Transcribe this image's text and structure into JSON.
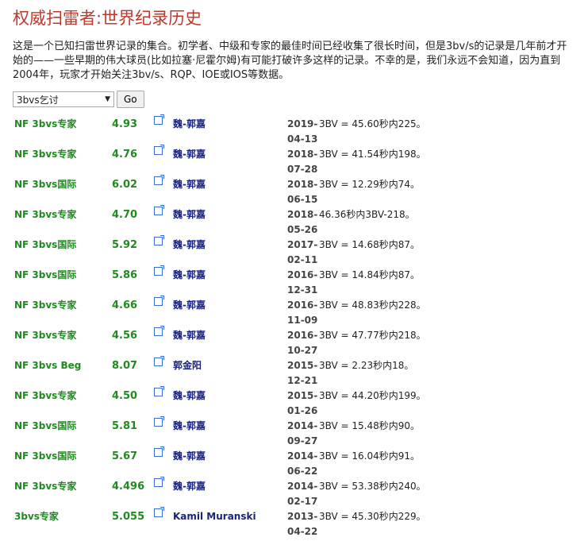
{
  "page": {
    "title": "权威扫雷者:世界纪录历史",
    "intro": "这是一个已知扫雷世界记录的集合。初学者、中级和专家的最佳时间已经收集了很长时间，但是3bv/s的记录是几年前才开始的——一些早期的伟大球员(比如拉塞·尼霍尔姆)有可能打破许多这样的记录。不幸的是，我们永远不会知道，因为直到2004年，玩家才开始关注3bv/s、RQP、IOE或IOS等数据。"
  },
  "controls": {
    "select_value": "3bvs乞讨",
    "go_label": "Go"
  },
  "records": [
    {
      "type": "NF 3bvs专家",
      "value": "4.93",
      "name": "魏-郭嘉",
      "date_line1": "2019-",
      "date_line2": "04-13",
      "desc": "3BV = 45.60秒内225。"
    },
    {
      "type": "NF 3bvs专家",
      "value": "4.76",
      "name": "魏-郭嘉",
      "date_line1": "2018-",
      "date_line2": "07-28",
      "desc": "3BV = 41.54秒内198。"
    },
    {
      "type": "NF 3bvs国际",
      "value": "6.02",
      "name": "魏-郭嘉",
      "date_line1": "2018-",
      "date_line2": "06-15",
      "desc": "3BV = 12.29秒内74。"
    },
    {
      "type": "NF 3bvs专家",
      "value": "4.70",
      "name": "魏-郭嘉",
      "date_line1": "2018-",
      "date_line2": "05-26",
      "desc": "46.36秒内3BV-218。"
    },
    {
      "type": "NF 3bvs国际",
      "value": "5.92",
      "name": "魏-郭嘉",
      "date_line1": "2017-",
      "date_line2": "02-11",
      "desc": "3BV = 14.68秒内87。"
    },
    {
      "type": "NF 3bvs国际",
      "value": "5.86",
      "name": "魏-郭嘉",
      "date_line1": "2016-",
      "date_line2": "12-31",
      "desc": "3BV = 14.84秒内87。"
    },
    {
      "type": "NF 3bvs专家",
      "value": "4.66",
      "name": "魏-郭嘉",
      "date_line1": "2016-",
      "date_line2": "11-09",
      "desc": "3BV = 48.83秒内228。"
    },
    {
      "type": "NF 3bvs专家",
      "value": "4.56",
      "name": "魏-郭嘉",
      "date_line1": "2016-",
      "date_line2": "10-27",
      "desc": "3BV = 47.77秒内218。"
    },
    {
      "type": "NF 3bvs Beg",
      "value": "8.07",
      "name": "郭金阳",
      "date_line1": "2015-",
      "date_line2": "12-21",
      "desc": "3BV = 2.23秒内18。"
    },
    {
      "type": "NF 3bvs专家",
      "value": "4.50",
      "name": "魏-郭嘉",
      "date_line1": "2015-",
      "date_line2": "01-26",
      "desc": "3BV = 44.20秒内199。"
    },
    {
      "type": "NF 3bvs国际",
      "value": "5.81",
      "name": "魏-郭嘉",
      "date_line1": "2014-",
      "date_line2": "09-27",
      "desc": "3BV = 15.48秒内90。"
    },
    {
      "type": "NF 3bvs国际",
      "value": "5.67",
      "name": "魏-郭嘉",
      "date_line1": "2014-",
      "date_line2": "06-22",
      "desc": "3BV = 16.04秒内91。"
    },
    {
      "type": "NF 3bvs专家",
      "value": "4.496",
      "name": "魏-郭嘉",
      "date_line1": "2014-",
      "date_line2": "02-17",
      "desc": "3BV = 53.38秒内240。"
    },
    {
      "type": "3bvs专家",
      "value": "5.055",
      "name": "Kamil Muranski",
      "date_line1": "2013-",
      "date_line2": "04-22",
      "desc": "3BV = 45.30秒内229。"
    }
  ]
}
